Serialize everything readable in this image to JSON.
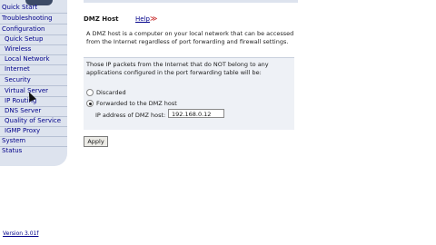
{
  "sidebar": {
    "items": [
      {
        "label": "Quick Start",
        "level": "top"
      },
      {
        "label": "Troubleshooting",
        "level": "top"
      },
      {
        "label": "Configuration",
        "level": "top"
      },
      {
        "label": "Quick Setup",
        "level": "sub"
      },
      {
        "label": "Wireless",
        "level": "sub"
      },
      {
        "label": "Local Network",
        "level": "sub"
      },
      {
        "label": "Internet",
        "level": "sub"
      },
      {
        "label": "Security",
        "level": "sub"
      },
      {
        "label": "Virtual Server",
        "level": "sub"
      },
      {
        "label": "IP Routing",
        "level": "sub"
      },
      {
        "label": "DNS Server",
        "level": "sub"
      },
      {
        "label": "Quality of Service",
        "level": "sub"
      },
      {
        "label": "IGMP Proxy",
        "level": "sub"
      },
      {
        "label": "System",
        "level": "top"
      },
      {
        "label": "Status",
        "level": "top"
      }
    ],
    "version": "Version 3.01f"
  },
  "main": {
    "title": "DMZ Host",
    "help_label": "Help",
    "help_arrow": "≫",
    "description": "A DMZ host is a computer on your local network that can be accessed from the Internet regardless of port forwarding and firewall settings.",
    "box_text": "Those IP packets from the Internet that do NOT belong to any applications configured in the port forwarding table will be:",
    "options": [
      {
        "label": "Discarded",
        "checked": false
      },
      {
        "label": "Forwarded to the DMZ host",
        "checked": true
      }
    ],
    "ip_label": "IP address of DMZ host:",
    "ip_value": "192.168.0.12",
    "apply_label": "Apply"
  }
}
